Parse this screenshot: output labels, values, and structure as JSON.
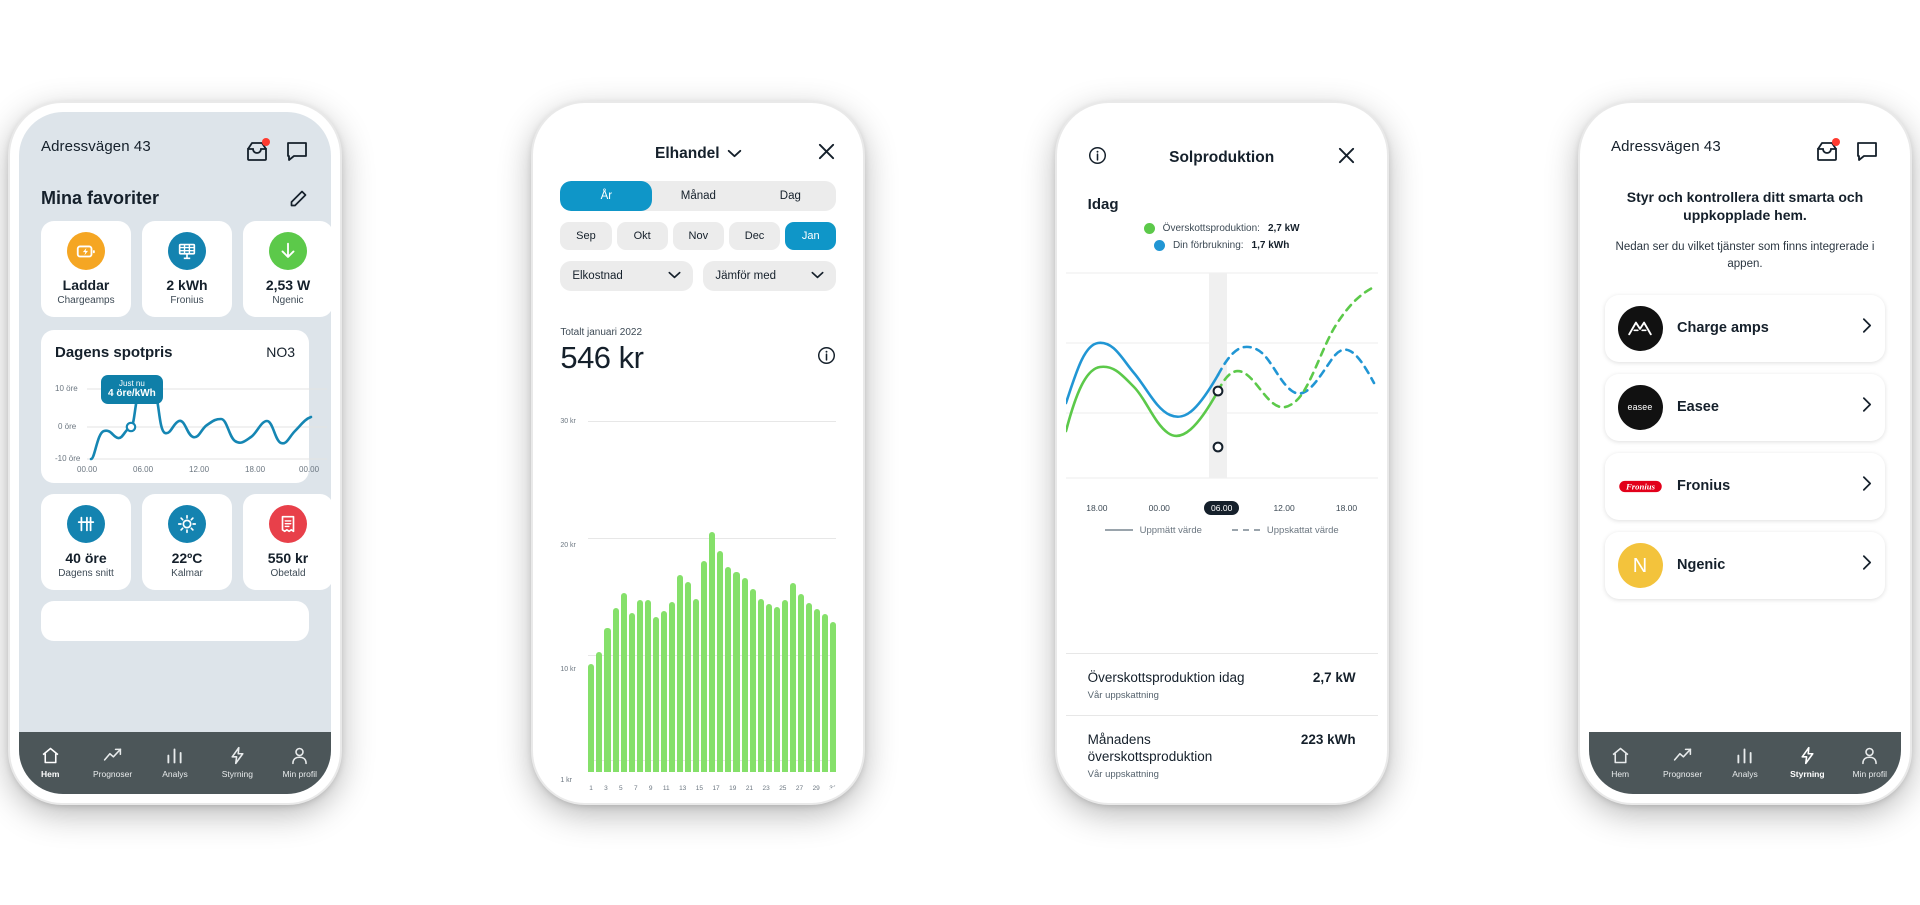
{
  "colors": {
    "brand_blue": "#0f96c8",
    "teal": "#0f7fa8",
    "green": "#5cc94a",
    "green_bar": "#85e06a",
    "orange": "#f5a623",
    "red": "#e8404a",
    "yellow": "#f3c33c",
    "tabbar": "#4c5659",
    "home_bg": "#dde4ea"
  },
  "phone1": {
    "address": "Adressvägen 43",
    "icons": {
      "inbox": "inbox-icon",
      "chat": "chat-icon"
    },
    "section_title": "Mina favoriter",
    "edit_icon": "edit-icon",
    "favorites": [
      {
        "value": "Laddar",
        "sub": "Chargeamps",
        "icon": "charging-battery-icon",
        "color": "#f5a623"
      },
      {
        "value": "2 kWh",
        "sub": "Fronius",
        "icon": "solar-panel-icon",
        "color": "#1483b0"
      },
      {
        "value": "2,53 W",
        "sub": "Ngenic",
        "icon": "arrow-down-icon",
        "color": "#5cc94a"
      }
    ],
    "spot": {
      "title": "Dagens spotpris",
      "zone": "NO3",
      "tooltip_label": "Just nu",
      "tooltip_value": "4 öre/kWh",
      "y_labels": [
        "10 öre",
        "0 öre",
        "-10 öre"
      ],
      "x_labels": [
        "00.00",
        "06.00",
        "12.00",
        "18.00",
        "00.00"
      ]
    },
    "favorites2": [
      {
        "value": "40 öre",
        "sub": "Dagens snitt",
        "icon": "price-average-icon",
        "color": "#1483b0"
      },
      {
        "value": "22ºC",
        "sub": "Kalmar",
        "icon": "sun-icon",
        "color": "#1483b0"
      },
      {
        "value": "550 kr",
        "sub": "Obetald",
        "icon": "invoice-icon",
        "color": "#e8404a"
      }
    ],
    "tabs": [
      {
        "label": "Hem",
        "icon": "home-icon",
        "active": true
      },
      {
        "label": "Prognoser",
        "icon": "trend-icon",
        "active": false
      },
      {
        "label": "Analys",
        "icon": "bars-icon",
        "active": false
      },
      {
        "label": "Styrning",
        "icon": "bolt-icon",
        "active": false
      },
      {
        "label": "Min profil",
        "icon": "person-icon",
        "active": false
      }
    ]
  },
  "phone2": {
    "title": "Elhandel",
    "chevron_icon": "chevron-down-icon",
    "close_icon": "close-icon",
    "segments": [
      {
        "label": "År",
        "active": true
      },
      {
        "label": "Månad",
        "active": false
      },
      {
        "label": "Dag",
        "active": false
      }
    ],
    "months": [
      {
        "label": "Sep",
        "active": false
      },
      {
        "label": "Okt",
        "active": false
      },
      {
        "label": "Nov",
        "active": false
      },
      {
        "label": "Dec",
        "active": false
      },
      {
        "label": "Jan",
        "active": true
      }
    ],
    "selects": [
      {
        "value": "Elkostnad",
        "icon": "chevron-down-icon"
      },
      {
        "value": "Jämför med",
        "icon": "chevron-down-icon"
      }
    ],
    "total_label": "Totalt januari 2022",
    "total_value": "546 kr",
    "info_icon": "info-icon"
  },
  "phone3": {
    "title": "Solproduktion",
    "info_icon": "info-icon",
    "close_icon": "close-icon",
    "subtitle": "Idag",
    "legend": [
      {
        "label": "Överskottsproduktion:",
        "value": "2,7 kW",
        "color": "#5cc94a"
      },
      {
        "label": "Din förbrukning:",
        "value": "1,7 kWh",
        "color": "#2196d4"
      }
    ],
    "x_labels": [
      "18.00",
      "00.00",
      "06.00",
      "12.00",
      "18.00"
    ],
    "highlight_x": "06.00",
    "key": [
      {
        "label": "Uppmätt värde",
        "style": "solid"
      },
      {
        "label": "Uppskattat värde",
        "style": "dashed"
      }
    ],
    "stats": [
      {
        "name": "Överskottsproduktion idag",
        "sub": "Vår uppskattning",
        "value": "2,7 kW"
      },
      {
        "name": "Månadens överskottsproduktion",
        "sub": "Vår uppskattning",
        "value": "223 kWh"
      }
    ]
  },
  "phone4": {
    "address": "Adressvägen 43",
    "icons": {
      "inbox": "inbox-icon",
      "chat": "chat-icon"
    },
    "heading": "Styr och kontrollera ditt smarta och uppkopplade hem.",
    "paragraph": "Nedan ser du vilket tjänster som finns integrerade i appen.",
    "services": [
      {
        "name": "Charge amps",
        "logo": "chargeamps-logo-icon",
        "bg": "#111111",
        "chevron": "chevron-right-icon"
      },
      {
        "name": "Easee",
        "logo": "easee-logo-icon",
        "bg": "#111111",
        "chevron": "chevron-right-icon"
      },
      {
        "name": "Fronius",
        "logo": "fronius-logo-icon",
        "bg": "#ffffff",
        "chevron": "chevron-right-icon"
      },
      {
        "name": "Ngenic",
        "logo": "ngenic-logo-icon",
        "bg": "#f3c33c",
        "chevron": "chevron-right-icon"
      }
    ],
    "tabs": [
      {
        "label": "Hem",
        "icon": "home-icon",
        "active": false
      },
      {
        "label": "Prognoser",
        "icon": "trend-icon",
        "active": false
      },
      {
        "label": "Analys",
        "icon": "bars-icon",
        "active": false
      },
      {
        "label": "Styrning",
        "icon": "bolt-icon",
        "active": true
      },
      {
        "label": "Min profil",
        "icon": "person-icon",
        "active": false
      }
    ]
  },
  "chart_data": [
    {
      "type": "line",
      "name": "Dagens spotpris",
      "title": "Dagens spotpris",
      "xlabel": "",
      "ylabel": "öre",
      "ylim": [
        -10,
        10
      ],
      "yticks": [
        10,
        0,
        -10
      ],
      "ytick_labels": [
        "10 öre",
        "0 öre",
        "-10 öre"
      ],
      "x": [
        "00.00",
        "06.00",
        "12.00",
        "18.00",
        "00.00"
      ],
      "grid": true,
      "annotation": {
        "text": "Just nu 4 öre/kWh",
        "x": "06.00",
        "y": 4
      },
      "values": [
        -10,
        -1,
        -3,
        -4,
        4,
        10,
        8,
        -2,
        -3,
        1,
        -4,
        -5,
        0,
        1,
        -3,
        -6,
        -4,
        2
      ]
    },
    {
      "type": "bar",
      "name": "Elkostnad januari 2022",
      "title": "Totalt januari 2022",
      "subtitle": "546 kr",
      "xlabel": "",
      "ylabel": "kr",
      "ylim": [
        0,
        32
      ],
      "yticks": [
        30,
        20,
        10,
        1
      ],
      "ytick_labels": [
        "30 kr",
        "20 kr",
        "10 kr",
        "1 kr"
      ],
      "categories": [
        "1",
        "2",
        "3",
        "4",
        "5",
        "6",
        "7",
        "8",
        "9",
        "10",
        "11",
        "12",
        "13",
        "14",
        "15",
        "16",
        "17",
        "18",
        "19",
        "20",
        "21",
        "22",
        "23",
        "24",
        "25",
        "26",
        "27",
        "28",
        "29",
        "30",
        "31"
      ],
      "values": [
        9.2,
        10.2,
        12.3,
        14.0,
        15.3,
        13.6,
        14.7,
        14.7,
        13.2,
        13.7,
        14.5,
        16.8,
        16.2,
        14.8,
        18.0,
        20.5,
        18.9,
        17.5,
        17.1,
        16.6,
        15.6,
        14.8,
        14.3,
        14.1,
        14.7,
        16.1,
        15.2,
        14.4,
        13.9,
        13.5,
        12.8
      ],
      "grid": true,
      "color": "#85e06a"
    },
    {
      "type": "line",
      "name": "Solproduktion idag",
      "title": "Idag",
      "xlabel": "",
      "ylabel": "kW",
      "x": [
        "18.00",
        "00.00",
        "06.00",
        "12.00",
        "18.00"
      ],
      "grid": true,
      "series": [
        {
          "name": "Överskottsproduktion",
          "color": "#5cc94a",
          "value_now": 2.7,
          "unit": "kW"
        },
        {
          "name": "Din förbrukning",
          "color": "#2196d4",
          "value_now": 1.7,
          "unit": "kWh"
        }
      ],
      "key": [
        "Uppmätt värde",
        "Uppskattat värde"
      ]
    }
  ]
}
